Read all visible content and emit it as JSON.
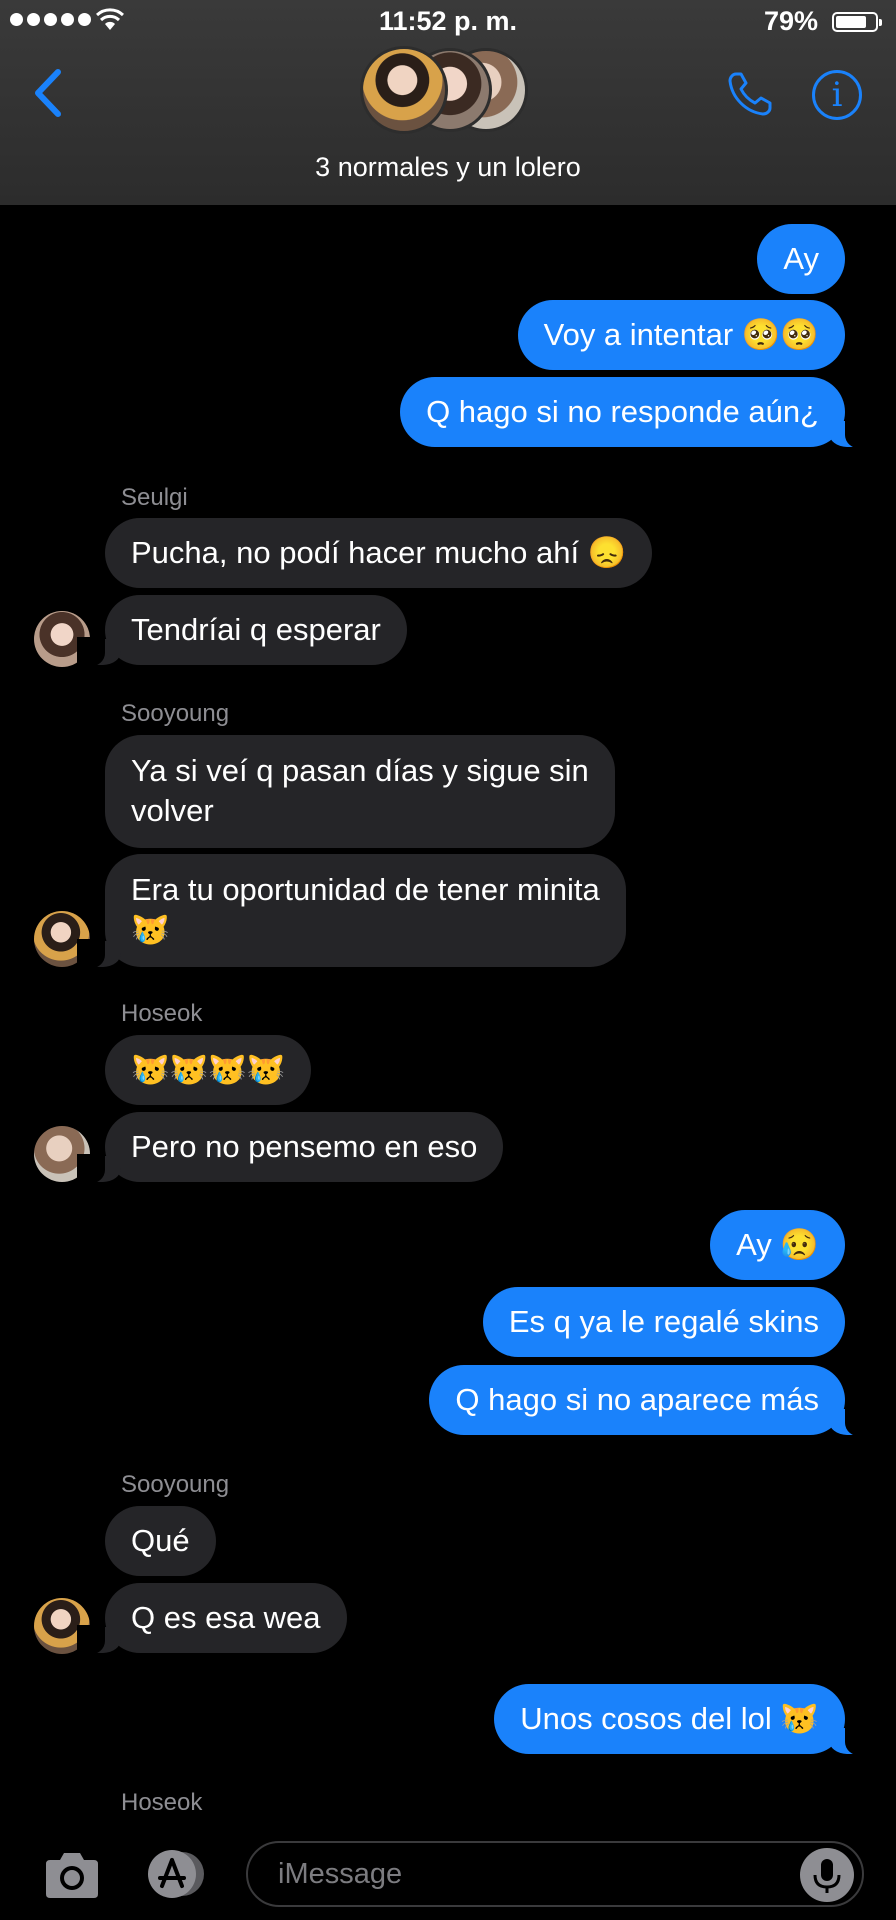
{
  "status_bar": {
    "time": "11:52 p. m.",
    "battery": "79%",
    "battery_level": 0.79
  },
  "header": {
    "chat_title": "3 normales y un lolero"
  },
  "colors": {
    "accent": "#1a82fb",
    "outgoing_bubble": "#1a82fb",
    "incoming_bubble": "#252528",
    "header_bg": "#333333"
  },
  "messages": {
    "m1": "Ay",
    "m2": "Voy a intentar 🥺🥺",
    "m3": "Q hago si no responde aún¿",
    "seulgi_name": "Seulgi",
    "m4": "Pucha, no podí hacer mucho ahí 😞",
    "m5": "Tendríai q esperar",
    "sooyoung_name_1": "Sooyoung",
    "m6_line1": "Ya si veí q pasan días y sigue sin",
    "m6_line2": "volver",
    "m7_line1": "Era tu oportunidad de tener minita",
    "m7_line2": "😿",
    "hoseok_name_1": "Hoseok",
    "m8": "😿😿😿😿",
    "m9": "Pero no pensemo en eso",
    "m10": "Ay 😥",
    "m11": "Es q ya le regalé skins",
    "m12": "Q hago si no aparece más",
    "sooyoung_name_2": "Sooyoung",
    "m13": "Qué",
    "m14": "Q es esa wea",
    "m15": "Unos cosos del lol 😿",
    "hoseok_name_2": "Hoseok"
  },
  "input": {
    "placeholder": "iMessage"
  },
  "icons": {
    "back": "chevron-left-icon",
    "phone": "phone-icon",
    "info": "info-icon",
    "camera": "camera-icon",
    "apps": "app-store-icon",
    "mic": "microphone-icon"
  }
}
